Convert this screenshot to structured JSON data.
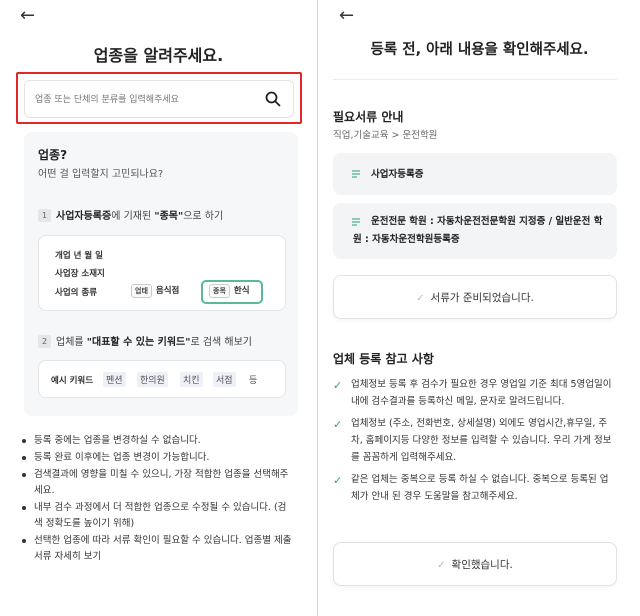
{
  "left": {
    "title": "업종을 알려주세요.",
    "search": {
      "placeholder": "업종 또는 단체의 분류를 입력해주세요"
    },
    "guide": {
      "question": "업종?",
      "subtitle": "어떤 걸 입력할지 고민되나요?",
      "step1": {
        "num": "1",
        "strong": "사업자등록증",
        "mid": "에 기재된 ",
        "quote": "\"종목\"",
        "end": "으로 하기"
      },
      "registration": {
        "line1": "개업 년 월 일",
        "line2": "사업장 소재지",
        "line3": "사업의 종류",
        "tag1": "업태",
        "value1": "음식점",
        "tag2": "종목",
        "value2": "한식"
      },
      "step2": {
        "num": "2",
        "pre": "업체를 ",
        "quote": "\"대표할 수 있는 키워드\"",
        "end": "로 검색 해보기"
      },
      "keywords": {
        "label": "예시 키워드",
        "items": [
          "펜션",
          "한의원",
          "치킨",
          "서점"
        ],
        "suffix": "등"
      }
    },
    "notes": [
      "등록 중에는 업종을 변경하실 수 없습니다.",
      "등록 완료 이후에는 업종 변경이 가능합니다.",
      "검색결과에 영향을 미칠 수 있으니, 가장 적합한 업종을 선택해주세요.",
      "내부 검수 과정에서 더 적합한 업종으로 수정될 수 있습니다. (검색 정확도를 높이기 위해)",
      "선택한 업종에 따라 서류 확인이 필요할 수 있습니다. 업종별 제출 서류 자세히 보기"
    ]
  },
  "right": {
    "title": "등록 전, 아래 내용을 확인해주세요.",
    "docs_section": {
      "title": "필요서류 안내",
      "subtitle": "직업,기술교육 > 운전학원",
      "doc1": "사업자등록증",
      "doc2": "운전전문 학원 : 자동차운전전문학원 지정증 / 일반운전 학원 : 자동차운전학원등록증"
    },
    "docs_button": "서류가 준비되었습니다.",
    "ref_section": {
      "title": "업체 등록 참고 사항",
      "items": [
        "업체정보 등록 후 검수가 필요한 경우 영업일 기준 최대 5영업일이내에 검수결과를 등록하신 메일, 문자로 알려드립니다.",
        "업체정보 (주소, 전화번호, 상세설명) 외에도 영업시간,휴무일, 주차, 홈페이지등 다양한 정보를 입력할 수 있습니다. 우리 가게 정보를 꼼꼼하게 입력해주세요.",
        "같은 업체는 중복으로 등록 하실 수 없습니다. 중복으로 등록된 업체가 안내 된 경우 도움말을 참고해주세요."
      ]
    },
    "confirm_button": "확인했습니다."
  },
  "colors": {
    "highlight": "#e0282a",
    "accent_green": "#3aa17e",
    "guide_bg": "#f6f7f9"
  },
  "icons": [
    "back-arrow-icon",
    "search-icon",
    "document-icon",
    "check-icon"
  ]
}
